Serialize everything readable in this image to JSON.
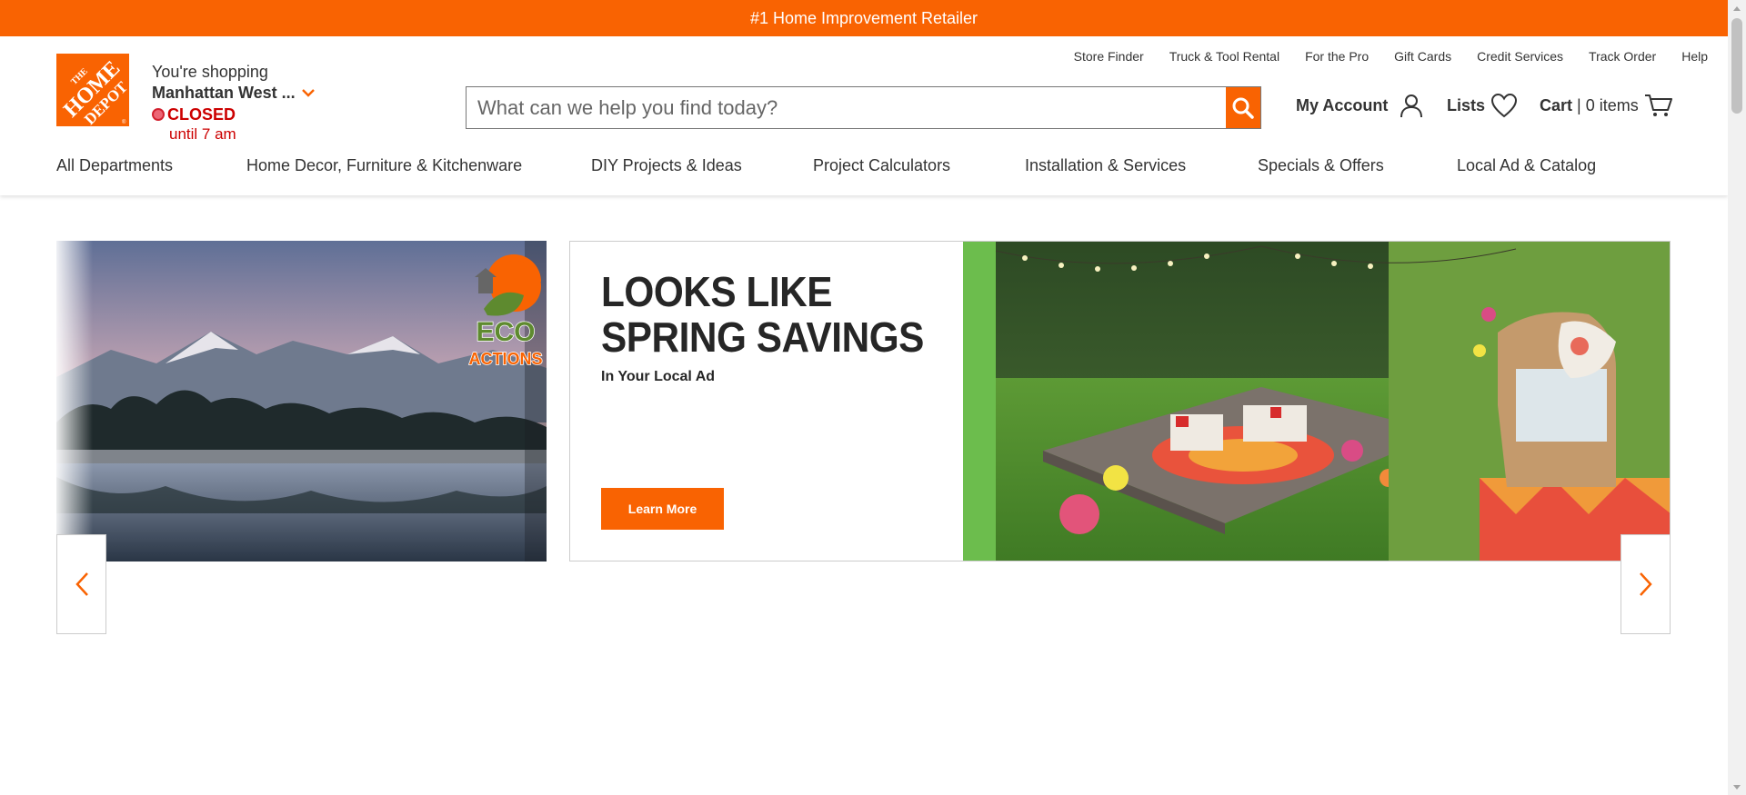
{
  "promo": {
    "text": "#1 Home Improvement Retailer"
  },
  "store": {
    "label": "You're shopping",
    "name": "Manhattan West ...",
    "status": "CLOSED",
    "until": "until 7 am"
  },
  "utility_links": [
    {
      "label": "Store Finder"
    },
    {
      "label": "Truck & Tool Rental"
    },
    {
      "label": "For the Pro"
    },
    {
      "label": "Gift Cards"
    },
    {
      "label": "Credit Services"
    },
    {
      "label": "Track Order"
    },
    {
      "label": "Help"
    }
  ],
  "search": {
    "placeholder": "What can we help you find today?",
    "icon": "search-icon"
  },
  "account": {
    "my_account": "My Account",
    "lists": "Lists",
    "cart": "Cart",
    "cart_sep": "|",
    "cart_count": "0 items"
  },
  "nav": [
    {
      "label": "All Departments"
    },
    {
      "label": "Home Decor, Furniture & Kitchenware"
    },
    {
      "label": "DIY Projects & Ideas"
    },
    {
      "label": "Project Calculators"
    },
    {
      "label": "Installation & Services"
    },
    {
      "label": "Specials & Offers"
    },
    {
      "label": "Local Ad & Catalog"
    }
  ],
  "hero_left": {
    "badge_line1": "ECO",
    "badge_line2": "ACTIONS"
  },
  "hero_card": {
    "headline_line1": "LOOKS LIKE",
    "headline_line2": "SPRING SAVINGS",
    "subhead": "In Your Local Ad",
    "cta": "Learn More"
  },
  "logo": {
    "text_line1": "THE",
    "text_line2": "HOME",
    "text_line3": "DEPOT"
  },
  "colors": {
    "brand_orange": "#f96302",
    "closed_red": "#cc0000",
    "text": "#333333"
  }
}
